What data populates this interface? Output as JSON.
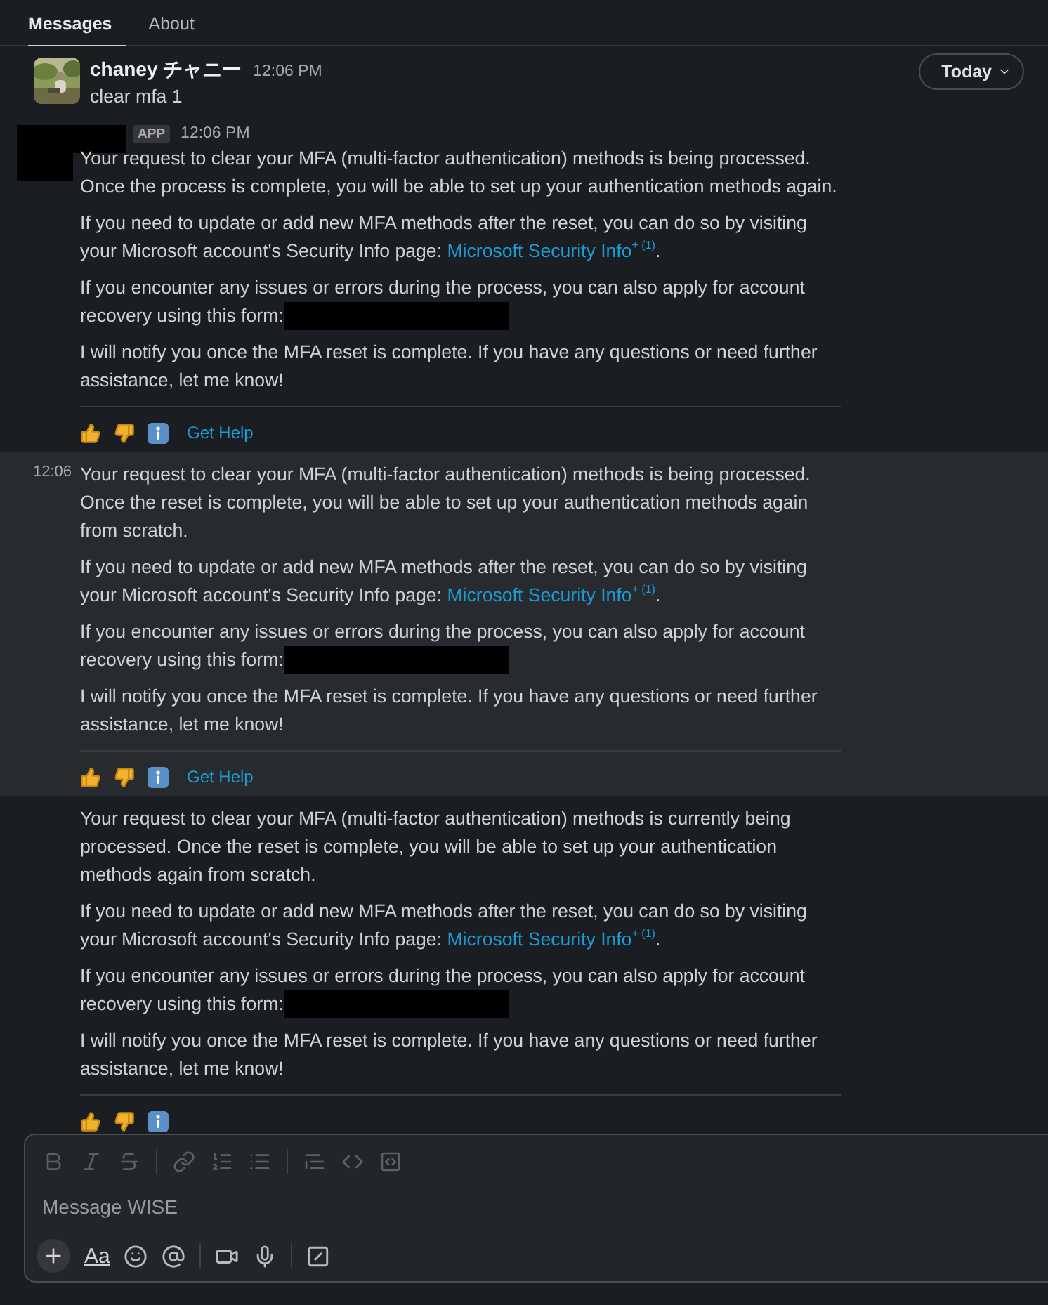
{
  "tabs": [
    {
      "label": "Messages",
      "selected": true
    },
    {
      "label": "About",
      "selected": false
    }
  ],
  "date_button": {
    "label": "Today"
  },
  "user_message": {
    "sender": "chaney チャニー",
    "time": "12:06 PM",
    "text": "clear mfa 1"
  },
  "bot_message": {
    "badge": "APP",
    "time": "12:06 PM",
    "replies": [
      {
        "highlighted": false,
        "paragraphs": [
          {
            "kind": "text",
            "text": "Your request to clear your MFA (multi-factor authentication) methods is being processed. Once the process is complete, you will be able to set up your authentication methods again."
          },
          {
            "kind": "link",
            "before": "If you need to update or add new MFA methods after the reset, you can do so by visiting your Microsoft account's Security Info page: ",
            "link": "Microsoft Security Info",
            "mark": "+ (1)",
            "after": "."
          },
          {
            "kind": "redacted",
            "text": "If you encounter any issues or errors during the process, you can also apply for account recovery using this form:"
          },
          {
            "kind": "text",
            "text": "I will notify you once the MFA reset is complete. If you have any questions or need further assistance, let me know!"
          }
        ],
        "action": "Get Help"
      },
      {
        "highlighted": true,
        "time": "12:06",
        "paragraphs": [
          {
            "kind": "text",
            "text": "Your request to clear your MFA (multi-factor authentication) methods is being processed. Once the reset is complete, you will be able to set up your authentication methods again from scratch."
          },
          {
            "kind": "link",
            "before": "If you need to update or add new MFA methods after the reset, you can do so by visiting your Microsoft account's Security Info page: ",
            "link": "Microsoft Security Info",
            "mark": "+ (1)",
            "after": "."
          },
          {
            "kind": "redacted",
            "text": "If you encounter any issues or errors during the process, you can also apply for account recovery using this form:"
          },
          {
            "kind": "text",
            "text": "I will notify you once the MFA reset is complete. If you have any questions or need further assistance, let me know!"
          }
        ],
        "action": "Get Help"
      },
      {
        "highlighted": false,
        "paragraphs": [
          {
            "kind": "text",
            "text": "Your request to clear your MFA (multi-factor authentication) methods is currently being processed. Once the reset is complete, you will be able to set up your authentication methods again from scratch."
          },
          {
            "kind": "link",
            "before": "If you need to update or add new MFA methods after the reset, you can do so by visiting your Microsoft account's Security Info page: ",
            "link": "Microsoft Security Info",
            "mark": "+ (1)",
            "after": "."
          },
          {
            "kind": "redacted",
            "text": "If you encounter any issues or errors during the process, you can also apply for account recovery using this form:"
          },
          {
            "kind": "text",
            "text": "I will notify you once the MFA reset is complete. If you have any questions or need further assistance, let me know!"
          }
        ]
      }
    ]
  },
  "composer": {
    "placeholder": "Message WISE",
    "format_label": "Aa"
  }
}
